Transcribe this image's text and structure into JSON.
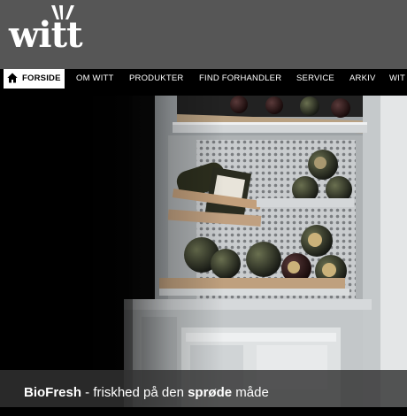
{
  "logo": {
    "text": "witt"
  },
  "nav": {
    "items": [
      {
        "label": "FORSIDE"
      },
      {
        "label": "OM WITT"
      },
      {
        "label": "PRODUKTER"
      },
      {
        "label": "FIND FORHANDLER"
      },
      {
        "label": "SERVICE"
      },
      {
        "label": "ARKIV"
      },
      {
        "label": "WIT"
      }
    ]
  },
  "hero": {
    "caption": {
      "brand": "BioFresh",
      "text1": " - friskhed på den ",
      "highlight": "sprøde",
      "text2": " måde"
    }
  }
}
